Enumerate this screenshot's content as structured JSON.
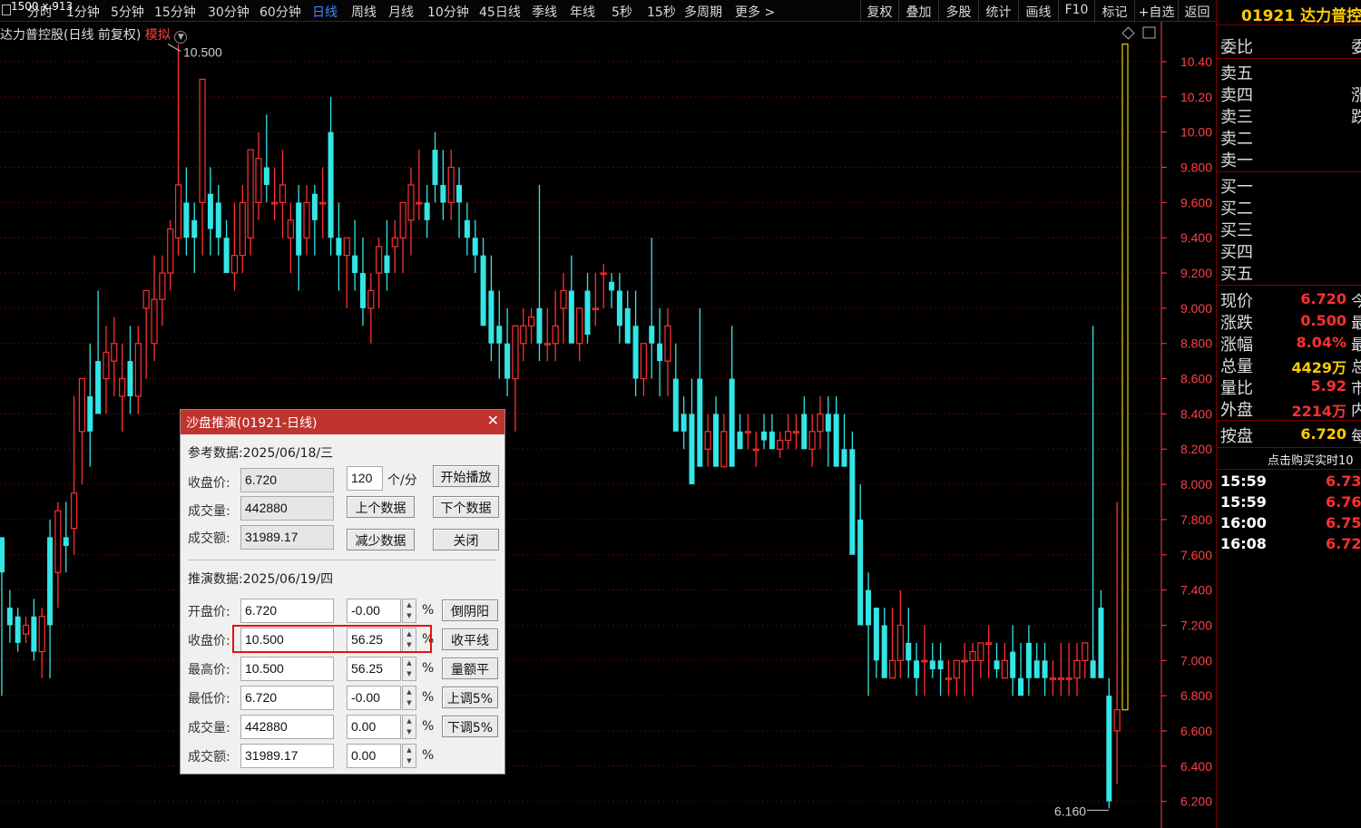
{
  "window_dims": "1500 x 913",
  "periods": [
    "分时",
    "1分钟",
    "5分钟",
    "15分钟",
    "30分钟",
    "60分钟",
    "日线",
    "周线",
    "月线",
    "10分钟",
    "45日线",
    "季线",
    "年线",
    "5秒",
    "15秒",
    "多周期",
    "更多 >"
  ],
  "active_period": "日线",
  "tools": [
    "复权",
    "叠加",
    "多股",
    "统计",
    "画线",
    "F10",
    "标记",
    "+自选",
    "返回"
  ],
  "stock_title": "达力普控股(日线 前复权)",
  "sim_label": "模拟",
  "price_axis": [
    "10.40",
    "10.20",
    "10.00",
    "9.800",
    "9.600",
    "9.400",
    "9.200",
    "9.000",
    "8.800",
    "8.600",
    "8.400",
    "8.200",
    "8.000",
    "7.800",
    "7.600",
    "7.400",
    "7.200",
    "7.000",
    "6.800",
    "6.600",
    "6.400",
    "6.200"
  ],
  "high_marker": "10.500",
  "low_marker": "6.160",
  "colors": {
    "up": "#ff3030",
    "down": "#33e6e6",
    "grid": "#5a0000",
    "axis": "#ff4040",
    "yellow": "#e6d200"
  },
  "chart_data": {
    "type": "candlestick",
    "ylim": [
      6.1,
      10.55
    ],
    "y_ticks": [
      10.4,
      10.2,
      10.0,
      9.8,
      9.6,
      9.4,
      9.2,
      9.0,
      8.8,
      8.6,
      8.4,
      8.2,
      8.0,
      7.8,
      7.6,
      7.4,
      7.2,
      7.0,
      6.8,
      6.6,
      6.4,
      6.2
    ],
    "candles": [
      [
        7.7,
        7.7,
        6.8,
        7.5
      ],
      [
        7.3,
        7.4,
        7.1,
        7.2
      ],
      [
        7.25,
        7.3,
        7.05,
        7.1
      ],
      [
        7.15,
        7.25,
        7.1,
        7.2
      ],
      [
        7.25,
        7.35,
        7.0,
        7.05
      ],
      [
        7.05,
        7.3,
        6.9,
        7.25
      ],
      [
        7.7,
        7.8,
        6.9,
        7.2
      ],
      [
        7.5,
        7.9,
        7.3,
        7.85
      ],
      [
        7.7,
        7.9,
        7.5,
        7.65
      ],
      [
        7.75,
        8.5,
        7.6,
        7.95
      ],
      [
        8.3,
        8.4,
        8.0,
        8.6
      ],
      [
        8.5,
        8.8,
        8.1,
        8.3
      ],
      [
        8.7,
        9.1,
        8.5,
        8.4
      ],
      [
        8.6,
        8.9,
        8.4,
        8.75
      ],
      [
        8.7,
        8.95,
        8.5,
        8.8
      ],
      [
        8.5,
        8.8,
        8.3,
        8.6
      ],
      [
        8.7,
        8.9,
        8.4,
        8.5
      ],
      [
        8.5,
        8.9,
        8.4,
        8.8
      ],
      [
        9.0,
        9.0,
        8.6,
        9.1
      ],
      [
        8.8,
        9.3,
        8.7,
        9.05
      ],
      [
        9.05,
        9.3,
        8.9,
        9.2
      ],
      [
        9.2,
        9.5,
        9.1,
        9.45
      ],
      [
        9.4,
        10.5,
        9.3,
        9.7
      ],
      [
        9.6,
        9.8,
        9.3,
        9.4
      ],
      [
        9.5,
        9.6,
        9.2,
        9.4
      ],
      [
        9.6,
        10.2,
        9.3,
        10.3
      ],
      [
        9.65,
        9.8,
        9.3,
        9.45
      ],
      [
        9.6,
        9.7,
        9.3,
        9.4
      ],
      [
        9.4,
        9.5,
        9.2,
        9.2
      ],
      [
        9.2,
        9.6,
        9.1,
        9.3
      ],
      [
        9.3,
        9.7,
        9.2,
        9.6
      ],
      [
        9.4,
        9.7,
        9.3,
        9.9
      ],
      [
        9.6,
        10.0,
        9.5,
        9.85
      ],
      [
        9.8,
        10.1,
        9.6,
        9.7
      ],
      [
        9.6,
        9.8,
        9.5,
        9.6
      ],
      [
        9.6,
        9.9,
        9.4,
        9.7
      ],
      [
        9.4,
        9.6,
        9.2,
        9.5
      ],
      [
        9.6,
        9.7,
        9.1,
        9.3
      ],
      [
        9.4,
        9.7,
        9.3,
        9.6
      ],
      [
        9.65,
        9.7,
        9.3,
        9.5
      ],
      [
        9.6,
        9.8,
        9.4,
        9.6
      ],
      [
        10.0,
        10.2,
        9.3,
        9.4
      ],
      [
        9.4,
        9.6,
        9.1,
        9.3
      ],
      [
        9.3,
        9.4,
        9.0,
        9.4
      ],
      [
        9.3,
        9.5,
        9.1,
        9.2
      ],
      [
        9.2,
        9.4,
        8.9,
        9.0
      ],
      [
        9.0,
        9.2,
        8.8,
        9.1
      ],
      [
        9.2,
        9.4,
        9.0,
        9.35
      ],
      [
        9.3,
        9.5,
        9.1,
        9.2
      ],
      [
        9.35,
        9.5,
        9.2,
        9.4
      ],
      [
        9.4,
        9.6,
        9.2,
        9.6
      ],
      [
        9.5,
        9.8,
        9.3,
        9.7
      ],
      [
        9.6,
        9.9,
        9.5,
        9.6
      ],
      [
        9.6,
        9.7,
        9.4,
        9.5
      ],
      [
        9.9,
        10.0,
        9.6,
        9.7
      ],
      [
        9.7,
        9.9,
        9.5,
        9.6
      ],
      [
        9.6,
        9.9,
        9.5,
        9.8
      ],
      [
        9.7,
        9.8,
        9.4,
        9.6
      ],
      [
        9.5,
        9.6,
        9.3,
        9.4
      ],
      [
        9.4,
        9.5,
        9.2,
        9.3
      ],
      [
        9.3,
        9.4,
        8.9,
        8.9
      ],
      [
        9.1,
        9.3,
        8.7,
        8.8
      ],
      [
        8.9,
        9.1,
        8.6,
        8.8
      ],
      [
        8.8,
        9.0,
        8.5,
        8.6
      ],
      [
        8.6,
        8.9,
        8.3,
        8.9
      ],
      [
        8.8,
        9.0,
        8.7,
        8.9
      ],
      [
        8.9,
        9.0,
        8.8,
        8.95
      ],
      [
        9.0,
        9.7,
        8.7,
        8.8
      ],
      [
        8.8,
        9.0,
        8.7,
        8.8
      ],
      [
        8.8,
        9.1,
        8.7,
        8.9
      ],
      [
        9.0,
        9.2,
        8.8,
        9.1
      ],
      [
        9.1,
        9.3,
        8.8,
        8.8
      ],
      [
        8.8,
        9.0,
        8.7,
        9.0
      ],
      [
        9.1,
        9.2,
        8.8,
        8.85
      ],
      [
        9.0,
        9.2,
        8.9,
        9.0
      ],
      [
        9.2,
        9.25,
        9.0,
        9.2
      ],
      [
        9.15,
        9.2,
        9.0,
        9.1
      ],
      [
        9.1,
        9.2,
        8.8,
        8.9
      ],
      [
        9.0,
        9.1,
        8.8,
        8.8
      ],
      [
        8.9,
        9.1,
        8.5,
        8.6
      ],
      [
        8.6,
        8.8,
        8.5,
        8.8
      ],
      [
        8.9,
        9.4,
        8.6,
        8.8
      ],
      [
        8.8,
        9.0,
        8.5,
        8.7
      ],
      [
        8.7,
        9.0,
        8.5,
        8.9
      ],
      [
        8.6,
        8.8,
        8.4,
        8.3
      ],
      [
        8.4,
        8.5,
        8.2,
        8.3
      ],
      [
        8.4,
        8.6,
        8.1,
        8.0
      ],
      [
        8.6,
        9.0,
        8.1,
        8.1
      ],
      [
        8.2,
        8.4,
        8.1,
        8.3
      ],
      [
        8.4,
        8.5,
        8.1,
        8.1
      ],
      [
        8.1,
        8.4,
        8.1,
        8.3
      ],
      [
        8.6,
        8.9,
        8.1,
        8.1
      ],
      [
        8.3,
        8.4,
        8.2,
        8.2
      ],
      [
        8.3,
        8.4,
        8.2,
        8.3
      ],
      [
        8.2,
        8.3,
        8.1,
        8.2
      ],
      [
        8.3,
        8.4,
        8.2,
        8.25
      ],
      [
        8.3,
        8.4,
        8.2,
        8.2
      ],
      [
        8.2,
        8.3,
        8.15,
        8.25
      ],
      [
        8.25,
        8.4,
        8.2,
        8.3
      ],
      [
        8.3,
        8.4,
        8.2,
        8.3
      ],
      [
        8.4,
        8.5,
        8.2,
        8.2
      ],
      [
        8.2,
        8.4,
        8.1,
        8.3
      ],
      [
        8.3,
        8.5,
        8.2,
        8.4
      ],
      [
        8.4,
        8.5,
        8.1,
        8.3
      ],
      [
        8.4,
        8.5,
        8.2,
        8.1
      ],
      [
        8.2,
        8.4,
        8.1,
        8.1
      ],
      [
        8.2,
        8.3,
        7.9,
        7.6
      ],
      [
        7.8,
        8.0,
        7.5,
        7.2
      ],
      [
        7.4,
        7.5,
        6.8,
        7.2
      ],
      [
        7.3,
        7.3,
        6.9,
        7.0
      ],
      [
        7.2,
        7.3,
        6.9,
        6.9
      ],
      [
        6.9,
        7.3,
        6.9,
        7.0
      ],
      [
        7.0,
        7.4,
        6.9,
        7.2
      ],
      [
        7.1,
        7.3,
        6.9,
        7.0
      ],
      [
        7.0,
        7.1,
        6.8,
        6.9
      ],
      [
        7.0,
        7.2,
        6.8,
        7.0
      ],
      [
        7.0,
        7.1,
        6.9,
        6.95
      ],
      [
        7.0,
        7.1,
        6.8,
        6.95
      ],
      [
        6.9,
        7.0,
        6.8,
        6.9
      ],
      [
        6.9,
        7.0,
        6.8,
        7.0
      ],
      [
        7.0,
        7.1,
        6.8,
        7.0
      ],
      [
        7.0,
        7.1,
        6.8,
        7.05
      ],
      [
        7.0,
        7.1,
        6.9,
        7.1
      ],
      [
        7.1,
        7.2,
        6.9,
        7.1
      ],
      [
        7.0,
        7.1,
        6.9,
        6.95
      ],
      [
        6.9,
        7.1,
        6.9,
        7.0
      ],
      [
        7.05,
        7.2,
        6.8,
        6.9
      ],
      [
        6.9,
        7.1,
        6.8,
        6.8
      ],
      [
        7.1,
        7.2,
        6.8,
        6.9
      ],
      [
        7.0,
        7.1,
        6.9,
        6.9
      ],
      [
        7.0,
        7.1,
        6.8,
        6.9
      ],
      [
        6.9,
        7.0,
        6.8,
        6.9
      ],
      [
        6.9,
        7.1,
        6.8,
        6.9
      ],
      [
        6.9,
        7.1,
        6.8,
        6.9
      ],
      [
        6.9,
        7.1,
        6.8,
        7.0
      ],
      [
        7.0,
        7.1,
        6.9,
        7.1
      ],
      [
        7.0,
        8.9,
        6.9,
        6.9
      ],
      [
        7.3,
        7.4,
        6.9,
        6.9
      ],
      [
        6.8,
        6.9,
        6.16,
        6.2
      ],
      [
        6.6,
        7.9,
        6.3,
        6.72
      ],
      [
        6.72,
        10.5,
        6.72,
        10.5
      ]
    ]
  },
  "right_panel": {
    "code": "01921",
    "name": "达力普控",
    "webi_label": "委比",
    "webi_right": "委",
    "sell_labels": [
      "卖五",
      "卖四",
      "卖三",
      "卖二",
      "卖一"
    ],
    "sell_side": [
      "",
      "涨",
      "跌",
      "",
      ""
    ],
    "buy_labels": [
      "买一",
      "买二",
      "买三",
      "买四",
      "买五"
    ],
    "stats": [
      {
        "label": "现价",
        "value": "6.720",
        "color": "#ff3030",
        "tail": "今"
      },
      {
        "label": "涨跌",
        "value": "0.500",
        "color": "#ff3030",
        "tail": "最"
      },
      {
        "label": "涨幅",
        "value": "8.04%",
        "color": "#ff3030",
        "tail": "最"
      },
      {
        "label": "总量",
        "value": "4429万",
        "color": "#ffcc00",
        "tail": "总"
      },
      {
        "label": "量比",
        "value": "5.92",
        "color": "#ff3030",
        "tail": "市"
      },
      {
        "label": "外盘",
        "value": "2214万",
        "color": "#ff3030",
        "tail": "内"
      }
    ],
    "anpan_label": "按盘",
    "anpan_value": "6.720",
    "anpan_tail": "每",
    "buy_tip": "点击购买实时10",
    "ticks": [
      {
        "t": "15:59",
        "p": "6.73"
      },
      {
        "t": "15:59",
        "p": "6.76"
      },
      {
        "t": "16:00",
        "p": "6.75"
      },
      {
        "t": "16:08",
        "p": "6.72"
      }
    ]
  },
  "dialog": {
    "title": "沙盘推演(01921-日线)",
    "ref_header": "参考数据:2025/06/18/三",
    "ref_close_label": "收盘价:",
    "ref_close": "6.720",
    "ref_vol_label": "成交量:",
    "ref_vol": "442880",
    "ref_amt_label": "成交额:",
    "ref_amt": "31989.17",
    "speed_value": "120",
    "speed_unit": "个/分",
    "btn_play": "开始播放",
    "btn_prev": "上个数据",
    "btn_next": "下个数据",
    "btn_reduce": "减少数据",
    "btn_close": "关闭",
    "sim_header": "推演数据:2025/06/19/四",
    "rows": [
      {
        "label": "开盘价:",
        "value": "6.720",
        "pct": "-0.00",
        "btn": "倒阴阳"
      },
      {
        "label": "收盘价:",
        "value": "10.500",
        "pct": "56.25",
        "btn": "收平线"
      },
      {
        "label": "最高价:",
        "value": "10.500",
        "pct": "56.25",
        "btn": "量额平"
      },
      {
        "label": "最低价:",
        "value": "6.720",
        "pct": "-0.00",
        "btn": "上调5%"
      },
      {
        "label": "成交量:",
        "value": "442880",
        "pct": "0.00",
        "btn": "下调5%"
      },
      {
        "label": "成交额:",
        "value": "31989.17",
        "pct": "0.00",
        "btn": ""
      }
    ],
    "pct_sign": "%"
  }
}
